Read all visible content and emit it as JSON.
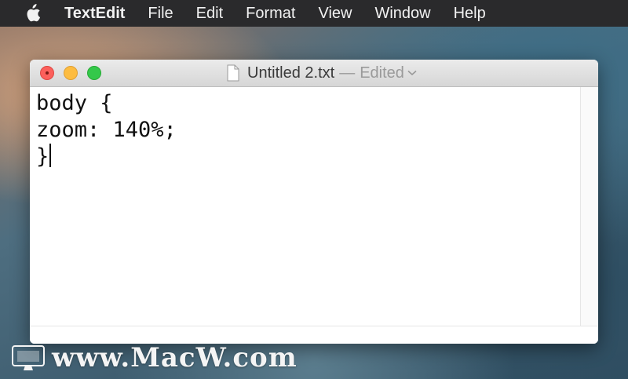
{
  "menubar": {
    "apple_icon": "apple-logo-icon",
    "app_name": "TextEdit",
    "items": [
      "File",
      "Edit",
      "Format",
      "View",
      "Window",
      "Help"
    ]
  },
  "window": {
    "title": "Untitled 2.txt",
    "separator": "—",
    "status": "Edited",
    "icons": [
      "document-icon",
      "chevron-down-icon"
    ]
  },
  "editor": {
    "lines": [
      "body {",
      "zoom: 140%;",
      "}"
    ]
  },
  "watermark": {
    "text": "www.MacW.com",
    "icon": "macw-logo-icon"
  },
  "colors": {
    "close": "#fc605c",
    "minimize": "#fdbc40",
    "zoom": "#34c84a",
    "menubar": "#2a2a2c"
  }
}
